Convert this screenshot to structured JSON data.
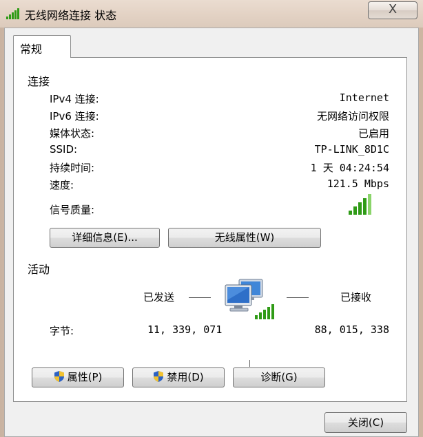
{
  "window": {
    "title": "无线网络连接 状态",
    "close_glyph": "X"
  },
  "tabs": [
    {
      "label": "常规"
    }
  ],
  "connection": {
    "heading": "连接",
    "rows": [
      {
        "label": "IPv4 连接:",
        "value": "Internet"
      },
      {
        "label": "IPv6 连接:",
        "value": "无网络访问权限"
      },
      {
        "label": "媒体状态:",
        "value": "已启用"
      },
      {
        "label": "SSID:",
        "value": "TP-LINK_8D1C"
      },
      {
        "label": "持续时间:",
        "value": "1 天 04:24:54"
      },
      {
        "label": "速度:",
        "value": "121.5 Mbps"
      }
    ],
    "signal_label": "信号质量:",
    "signal_bars": 5,
    "signal_bars_max": 5,
    "details_button": "详细信息(E)...",
    "wireless_props_button": "无线属性(W)"
  },
  "activity": {
    "heading": "活动",
    "sent_label": "已发送",
    "received_label": "已接收",
    "bytes_label": "字节:",
    "bytes_sent": "11, 339, 071",
    "bytes_received": "88, 015, 338"
  },
  "buttons": {
    "properties": "属性(P)",
    "disable": "禁用(D)",
    "diagnose": "诊断(G)",
    "close": "关闭(C)"
  },
  "colors": {
    "signal_green": "#2f9b16",
    "signal_green_light": "#8ad46a",
    "signal_gray": "#9a9a9a"
  },
  "icons": {
    "title": "wifi-signal-icon",
    "activity": "network-computers-icon",
    "shield": "uac-shield-icon"
  }
}
